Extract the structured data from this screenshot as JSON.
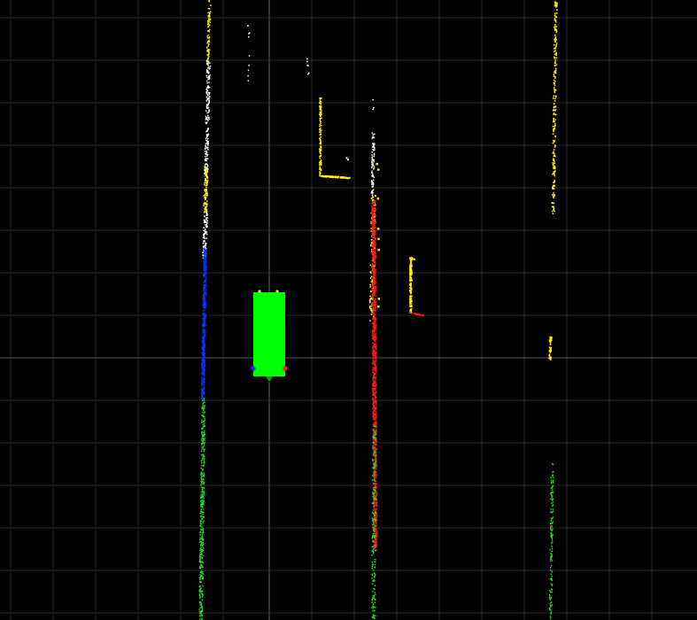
{
  "scene": {
    "background_color": "#000000",
    "grid_color": "#2a2a2a",
    "axis_color": "#5a5a5a"
  },
  "colors": {
    "ego_vehicle": "#00ff00",
    "lane_left": "#0033ff",
    "lane_right": "#ff1a1a",
    "lane_yellow": "#ffee00",
    "lane_white": "#ffffff",
    "lane_green": "#22dd22"
  },
  "legend_marks": {
    "left_marker": "blue-dot",
    "right_marker": "red-dot",
    "rear_marker": "green-arrow"
  }
}
